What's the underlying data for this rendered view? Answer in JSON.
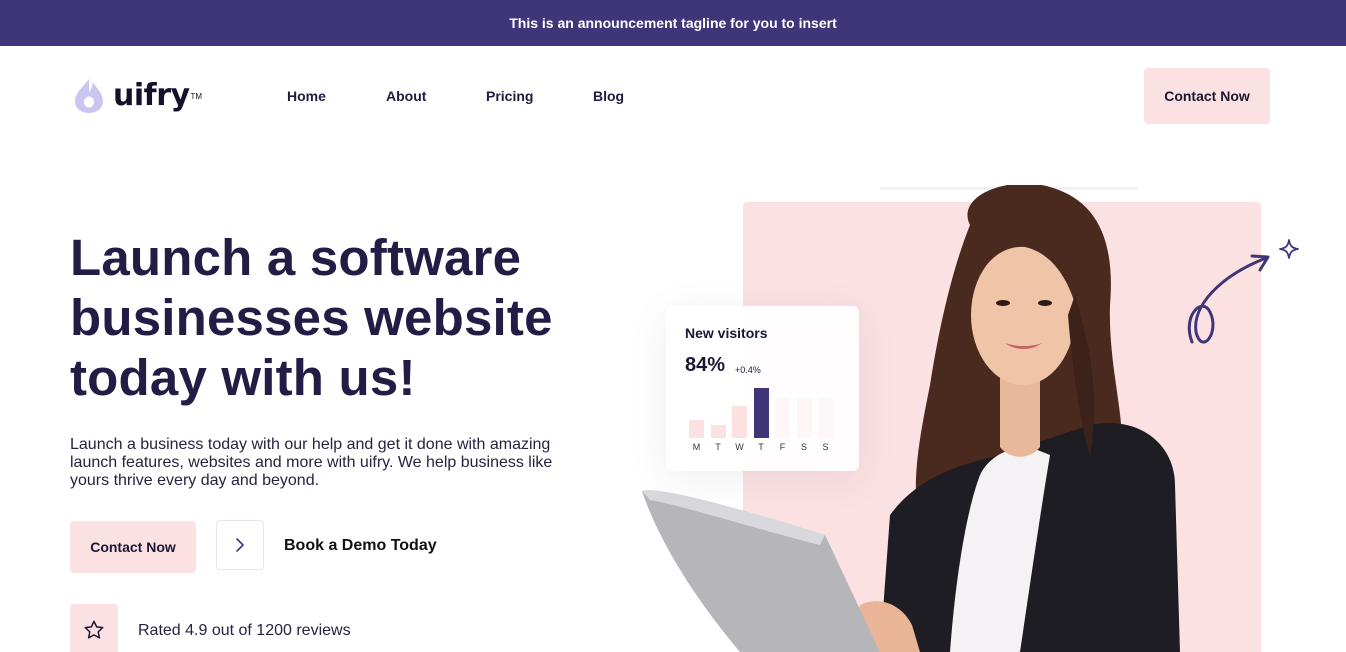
{
  "announcement": {
    "text": "This is an announcement tagline for you to insert"
  },
  "brand": {
    "name": "uifry",
    "trademark": "TM",
    "accent": "#3f3679",
    "pink": "#fbe1e2"
  },
  "nav": {
    "items": [
      {
        "label": "Home"
      },
      {
        "label": "About"
      },
      {
        "label": "Pricing"
      },
      {
        "label": "Blog"
      }
    ],
    "cta_label": "Contact Now"
  },
  "hero": {
    "title_lines": [
      "Launch a software",
      "businesses website",
      "today with us!"
    ],
    "description_lines": [
      "Launch a business today with our help and get it done with amazing",
      "launch features, websites and more with uifry. We help business like",
      "yours thrive every day and beyond."
    ],
    "primary_cta": "Contact Now",
    "secondary_cta": "Book a Demo Today",
    "rating_text": "Rated 4.9 out of 1200 reviews"
  },
  "stats_card": {
    "title": "New visitors",
    "value": "84%",
    "delta": "+0.4%",
    "days": [
      "M",
      "T",
      "W",
      "T",
      "F",
      "S",
      "S"
    ],
    "bar_levels": [
      0.36,
      0.26,
      0.64,
      1.0,
      0.8,
      0.8,
      0.8
    ],
    "highlight_index": 3
  },
  "icons": [
    "drop-logo-icon",
    "chevron-right-icon",
    "star-icon",
    "sparkle-icon",
    "curly-arrow-icon"
  ]
}
